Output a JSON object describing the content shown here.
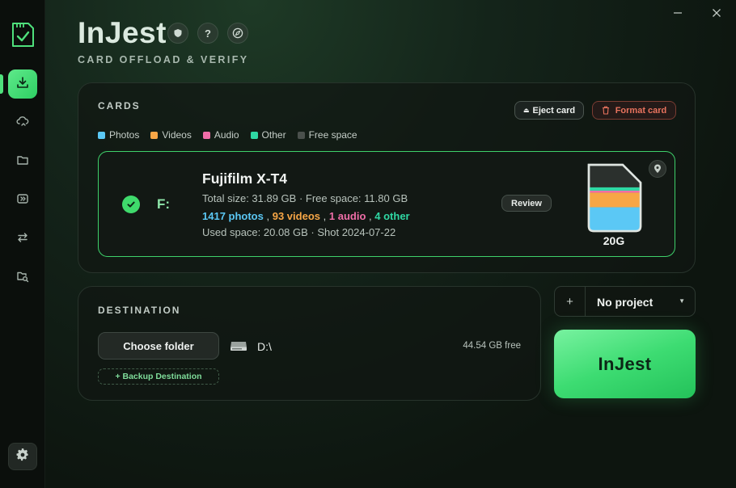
{
  "app": {
    "title": "InJest",
    "subtitle": "CARD OFFLOAD & VERIFY",
    "title_icons": [
      "shield-icon",
      "help-icon",
      "compass-icon"
    ]
  },
  "window": {
    "minimize": "—",
    "close": "✕"
  },
  "sidebar": {
    "items": [
      {
        "name": "import-icon",
        "active": true
      },
      {
        "name": "cloud-sync-icon",
        "active": false
      },
      {
        "name": "folder-icon",
        "active": false
      },
      {
        "name": "media-icon",
        "active": false
      },
      {
        "name": "transfer-icon",
        "active": false
      },
      {
        "name": "folder-search-icon",
        "active": false
      }
    ],
    "settings_icon": "gear-icon"
  },
  "cards": {
    "label": "CARDS",
    "eject_label": "Eject card",
    "format_label": "Format card",
    "legend": [
      {
        "label": "Photos",
        "color": "#5bc8f5"
      },
      {
        "label": "Videos",
        "color": "#f7a646"
      },
      {
        "label": "Audio",
        "color": "#f06ea8"
      },
      {
        "label": "Other",
        "color": "#2fd8a4"
      },
      {
        "label": "Free space",
        "color": "#4a504c"
      }
    ],
    "card": {
      "drive": "F:",
      "name": "Fujifilm X-T4",
      "total_line": "Total size: 31.89 GB · Free space: 11.80 GB",
      "photos": "1417 photos",
      "videos": "93 videos",
      "audio": "1 audio",
      "other": "4 other",
      "sep": ",",
      "used_line": "Used space: 20.08 GB  · Shot 2024-07-22",
      "review_label": "Review",
      "capacity": "20G",
      "fill": {
        "photos": 0.36,
        "videos": 0.22,
        "audio": 0.03,
        "other": 0.05
      }
    }
  },
  "destination": {
    "label": "DESTINATION",
    "choose_label": "Choose folder",
    "backup_label": "+ Backup Destination",
    "path": "D:\\",
    "free": "44.54 GB free"
  },
  "project": {
    "plus": "+",
    "selected": "No project",
    "caret": "▼"
  },
  "ingest": {
    "label": "InJest"
  },
  "colors": {
    "accent": "#3ddc72",
    "photos": "#5bc8f5",
    "videos": "#f7a646",
    "audio": "#f06ea8",
    "other": "#2fd8a4",
    "danger": "#e8735e"
  }
}
